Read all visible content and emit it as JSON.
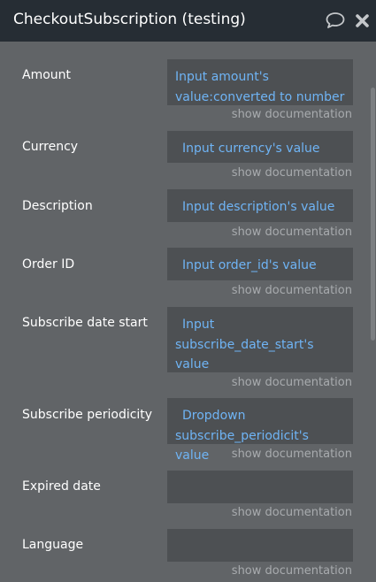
{
  "header": {
    "title": "CheckoutSubscription (testing)",
    "comment_icon": "speech-bubble-icon",
    "close_icon": "close-x-icon"
  },
  "doc_link": "show documentation",
  "fields": [
    {
      "label": "Amount",
      "value": "Input amount's value:converted to number"
    },
    {
      "label": "Currency",
      "value": "Input currency's value"
    },
    {
      "label": "Description",
      "value": "Input description's value"
    },
    {
      "label": "Order ID",
      "value": "Input order_id's value"
    },
    {
      "label": "Subscribe date start",
      "value": "Input subscribe_date_start's value"
    },
    {
      "label": "Subscribe periodicity",
      "value": "Dropdown subscribe_periodicit's value"
    },
    {
      "label": "Expired date",
      "value": ""
    },
    {
      "label": "Language",
      "value": ""
    }
  ],
  "colors": {
    "panel_bg": "#616467",
    "header_bg": "#262d34",
    "field_bg": "#4d5053",
    "value_text": "#6fb4f5",
    "doc_text": "#a8abae"
  }
}
